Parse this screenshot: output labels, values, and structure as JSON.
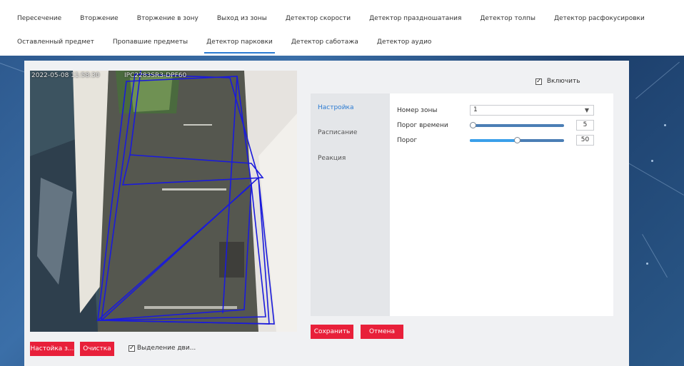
{
  "tabs": {
    "row1": [
      "Пересечение",
      "Вторжение",
      "Вторжение в зону",
      "Выход из зоны",
      "Детектор скорости",
      "Детектор праздношатания",
      "Детектор толпы",
      "Детектор расфокусировки"
    ],
    "row2": [
      "Оставленный предмет",
      "Пропавшие предметы",
      "Детектор парковки",
      "Детектор саботажа",
      "Детектор аудио"
    ],
    "active": "Детектор парковки"
  },
  "video": {
    "timestamp": "2022-05-08 11:58:30",
    "overlay_text": "IPC2283SR3-DPF60"
  },
  "video_controls": {
    "setup_area_label": "Настойка з...",
    "clear_label": "Очистка",
    "motion_highlight_label": "Выделение дви...",
    "motion_highlight_checked": true
  },
  "enable": {
    "label": "Включить",
    "checked": true
  },
  "side_menu": [
    "Настройка",
    "Расписание",
    "Реакция"
  ],
  "side_menu_active": "Настройка",
  "settings": {
    "zone_label": "Номер зоны",
    "zone_value": "1",
    "time_threshold_label": "Порог времени",
    "time_threshold_value": "5",
    "time_threshold_fraction": 0.0,
    "threshold_label": "Порог",
    "threshold_value": "50",
    "threshold_fraction": 0.5
  },
  "actions": {
    "save_label": "Сохранить",
    "cancel_label": "Отмена"
  },
  "colors": {
    "accent_blue": "#2b7bd2",
    "button_red": "#e8203a",
    "zone_lines": "#1a1adc"
  }
}
